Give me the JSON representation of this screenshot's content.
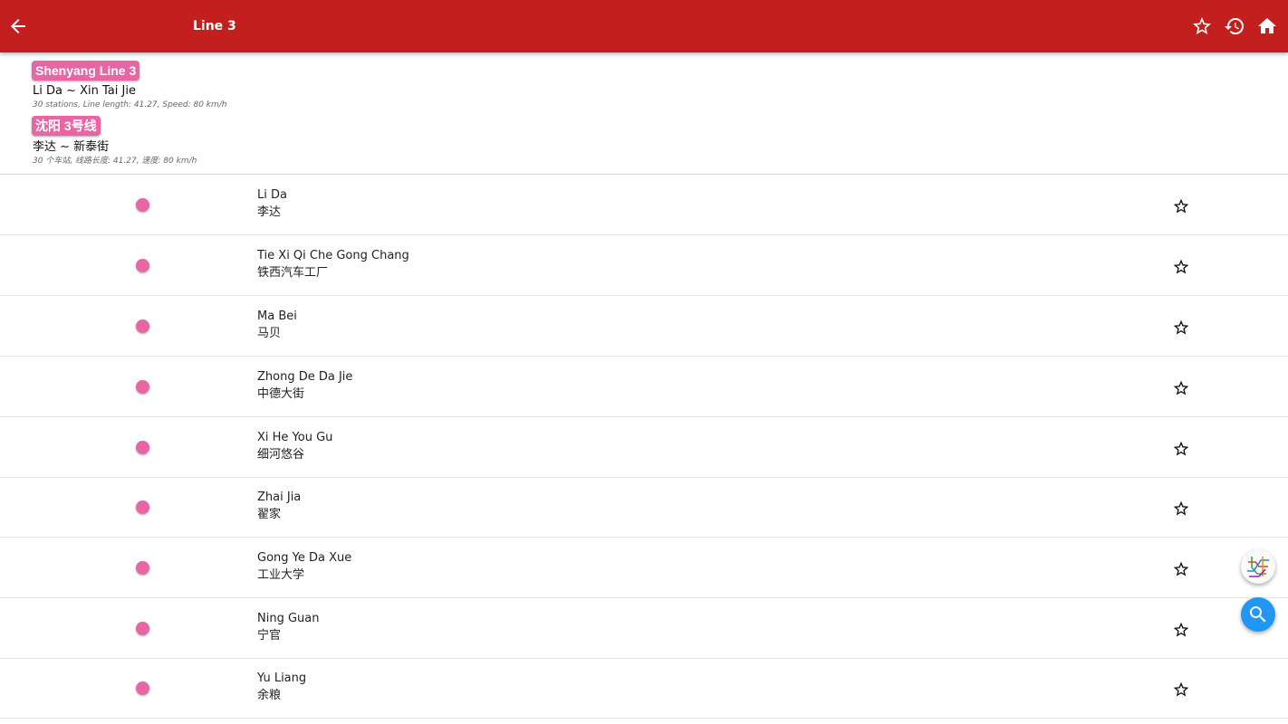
{
  "appbar": {
    "title": "Line 3",
    "back_icon": "arrow-left-icon",
    "actions": [
      "star-outline-icon",
      "history-icon",
      "home-icon"
    ],
    "color": "#c41f1f"
  },
  "line": {
    "color": "#e766a3",
    "en": {
      "name": "Shenyang Line 3",
      "route": "Li Da ~ Xin Tai Jie",
      "meta": "30 stations, Line length: 41.27, Speed: 80 km/h"
    },
    "zh": {
      "name": "沈阳 3号线",
      "route": "李达 ~ 新泰街",
      "meta": "30 个车站, 线路长度: 41.27, 速度: 80 km/h"
    }
  },
  "stations": [
    {
      "en": "Li Da",
      "zh": "李达"
    },
    {
      "en": "Tie Xi Qi Che Gong Chang",
      "zh": "铁西汽车工厂"
    },
    {
      "en": "Ma Bei",
      "zh": "马贝"
    },
    {
      "en": "Zhong De Da Jie",
      "zh": "中德大街"
    },
    {
      "en": "Xi He You Gu",
      "zh": "细河悠谷"
    },
    {
      "en": "Zhai Jia",
      "zh": "翟家"
    },
    {
      "en": "Gong Ye Da Xue",
      "zh": "工业大学"
    },
    {
      "en": "Ning Guan",
      "zh": "宁官"
    },
    {
      "en": "Yu Liang",
      "zh": "余粮"
    }
  ],
  "fabs": {
    "map_icon": "subway-map-icon",
    "search_icon": "search-icon",
    "search_color": "#2196f3"
  }
}
